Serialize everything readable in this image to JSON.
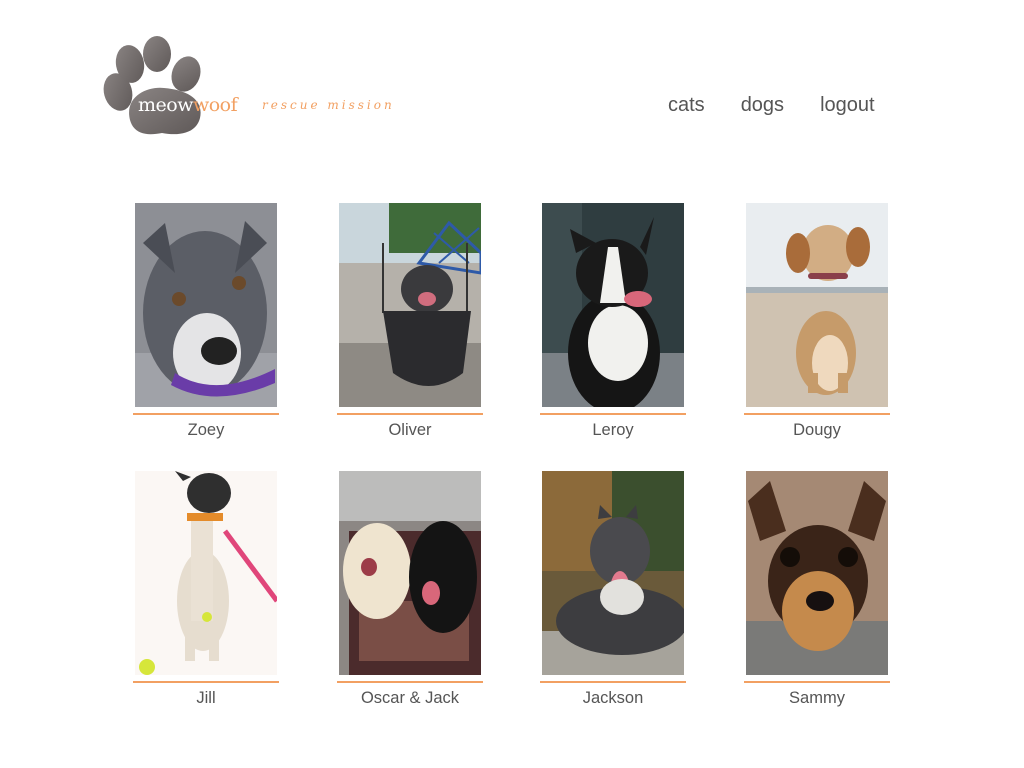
{
  "brand": {
    "logo_meow": "meow",
    "logo_woof": "woof",
    "tagline": "rescue mission",
    "accent_color": "#f2a062",
    "paw_color": "#7a7473"
  },
  "nav": {
    "cats": "cats",
    "dogs": "dogs",
    "logout": "logout"
  },
  "dogs": [
    {
      "name": "Zoey"
    },
    {
      "name": "Oliver"
    },
    {
      "name": "Leroy"
    },
    {
      "name": "Dougy"
    },
    {
      "name": "Jill"
    },
    {
      "name": "Oscar & Jack"
    },
    {
      "name": "Jackson"
    },
    {
      "name": "Sammy"
    }
  ]
}
